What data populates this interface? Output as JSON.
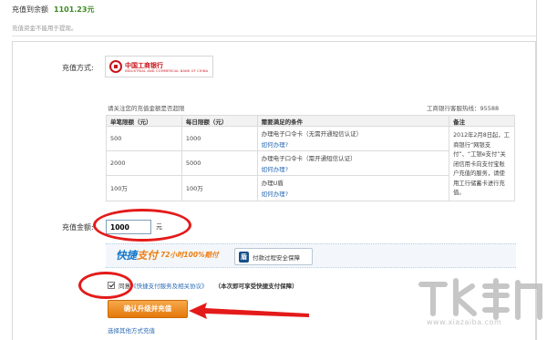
{
  "summary": {
    "title": "充值到余额",
    "amount": "1101.23元",
    "note": "充值资金不能用于提现。"
  },
  "form": {
    "method_label": "充值方式:",
    "bank": {
      "name": "中国工商银行",
      "english": "INDUSTRIAL AND COMMERCIAL BANK OF CHINA"
    },
    "hint": "请关注您的充值金额是否超限",
    "hotline": "工商银行客服热线：95588",
    "table": {
      "headers": [
        "单笔限额（元）",
        "每日限额（元）",
        "需要满足的条件",
        "备注"
      ],
      "rows": [
        {
          "single": "500",
          "daily": "1000",
          "condition": "办理电子口令卡（无需开通短信认证）",
          "link": "如何办理?"
        },
        {
          "single": "2000",
          "daily": "5000",
          "condition": "办理电子口令卡（需开通短信认证）",
          "link": "如何办理?"
        },
        {
          "single": "100万",
          "daily": "100万",
          "condition": "办理U盾",
          "link": "如何办理?"
        }
      ],
      "remark": "2012年2月8日起，工商银行“网银支付”、“工银e支付”关闭信用卡向支付宝账户充值的服务，请使用工行储蓄卡进行充值。"
    },
    "amount_label": "充值金额:",
    "amount_value": "1000",
    "unit": "元",
    "banner": {
      "title_a": "快捷",
      "title_b": "支付",
      "subtitle": "72小时100%赔付",
      "secure_icon": "盾",
      "secure_label": "付款过程安全保障"
    },
    "agree": {
      "prefix": "同意",
      "link": "《快捷支付服务及相关协议》",
      "note": "（本次即可享受快捷支付保障）"
    },
    "submit_label": "确认升级并充值",
    "other_link": "选择其他方式充值"
  },
  "watermark": {
    "text": "www.xiazaiba.com"
  },
  "colors": {
    "accent_green": "#3a8a22",
    "link_blue": "#2b6bb5",
    "button_orange": "#e4780b",
    "annotation_red": "#e41a1a"
  }
}
